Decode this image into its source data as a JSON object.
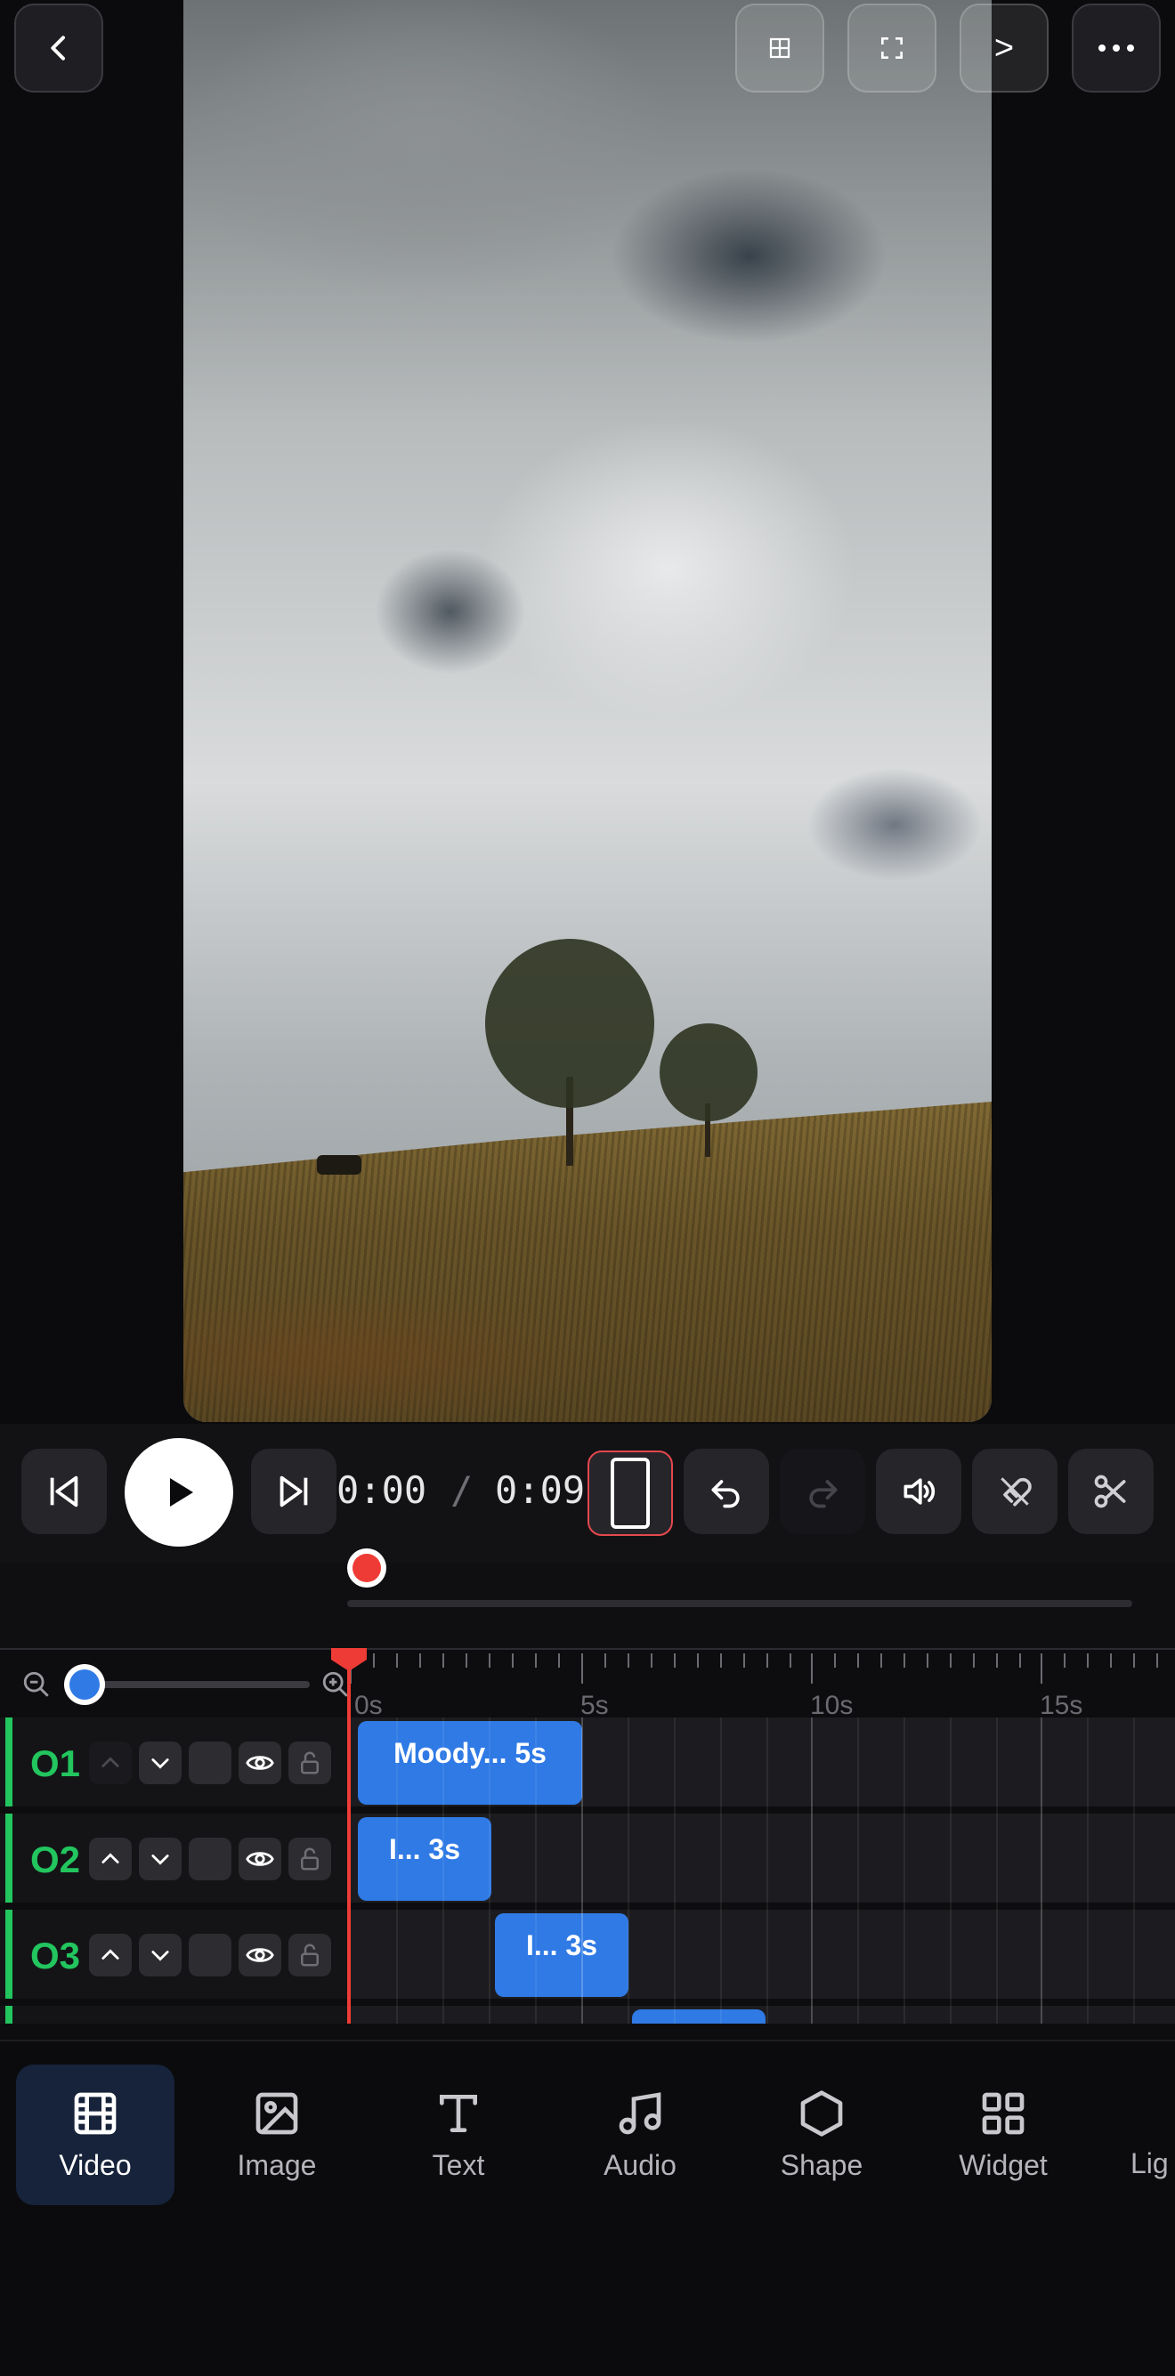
{
  "topbar": {
    "back_icon": "chevron-left-icon",
    "next_label": ">",
    "grid_icon": "grid-icon",
    "fullscreen_icon": "fullscreen-icon",
    "more_icon": "more-horizontal-icon"
  },
  "transport": {
    "current_time": "0:00",
    "separator": "/",
    "total_time": "0:09"
  },
  "ruler": {
    "labels": [
      "0s",
      "5s",
      "10s",
      "15s"
    ]
  },
  "tracks": [
    {
      "label": "O1",
      "clips": [
        {
          "text": "Moody... 5s"
        }
      ]
    },
    {
      "label": "O2",
      "clips": [
        {
          "text": "I... 3s"
        }
      ]
    },
    {
      "label": "O3",
      "clips": [
        {
          "text": "I... 3s"
        }
      ]
    }
  ],
  "nav": {
    "items": [
      {
        "label": "Video",
        "icon": "film-icon",
        "active": true
      },
      {
        "label": "Image",
        "icon": "image-icon"
      },
      {
        "label": "Text",
        "icon": "text-icon"
      },
      {
        "label": "Audio",
        "icon": "music-icon"
      },
      {
        "label": "Shape",
        "icon": "hexagon-icon"
      },
      {
        "label": "Widget",
        "icon": "widget-icon"
      },
      {
        "label": "Lig",
        "icon": "light-icon"
      }
    ]
  },
  "colors": {
    "accent": "#2f7ae5",
    "track_label": "#22c55e",
    "playhead": "#ef3b35"
  }
}
